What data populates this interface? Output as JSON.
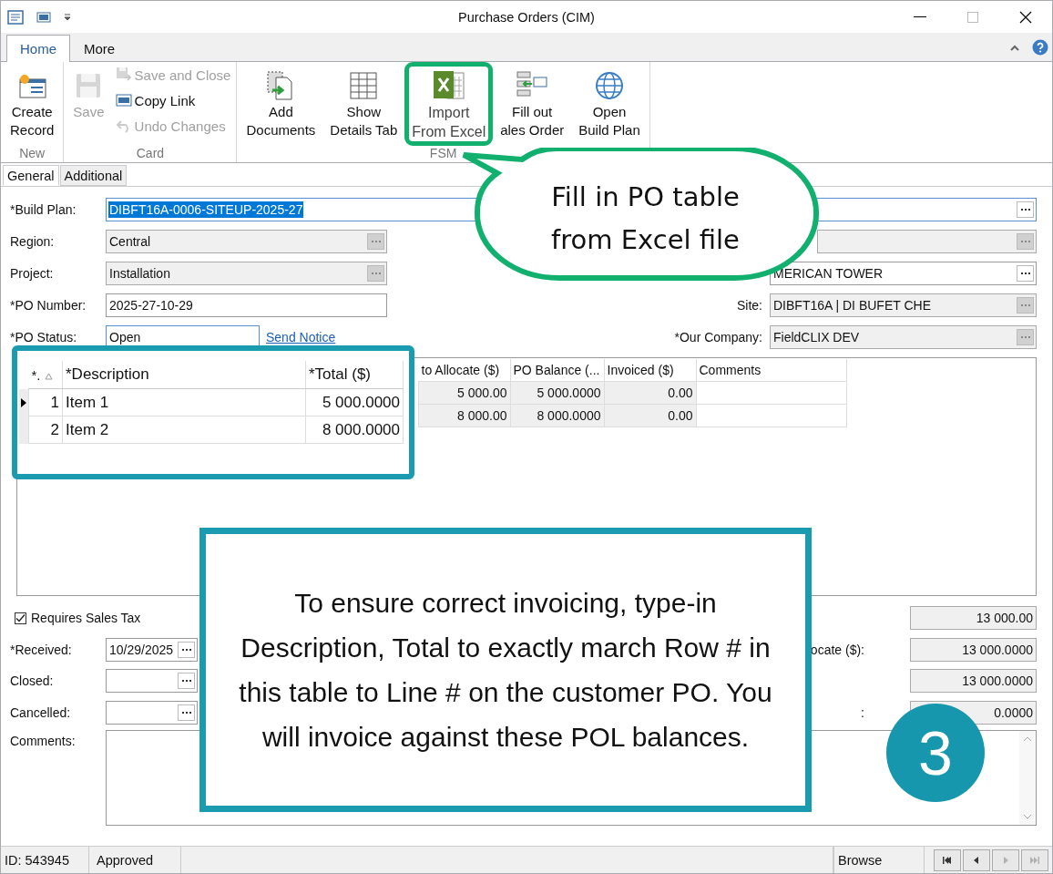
{
  "window": {
    "title": "Purchase Orders (CIM)"
  },
  "ribbon": {
    "tabs": [
      {
        "label": "Home",
        "selected": true
      },
      {
        "label": "More",
        "selected": false
      }
    ],
    "groups": [
      {
        "label": "New",
        "items": [
          {
            "kind": "large",
            "lines": [
              "Create",
              "Record"
            ],
            "disabled": false,
            "highlighted": false
          }
        ]
      },
      {
        "label": "Card",
        "items": [
          {
            "kind": "large",
            "lines": [
              "Save"
            ],
            "disabled": true,
            "highlighted": false
          },
          {
            "kind": "small",
            "lines": [
              "Save and Close"
            ],
            "disabled": true
          },
          {
            "kind": "small",
            "lines": [
              "Copy Link"
            ],
            "disabled": false
          },
          {
            "kind": "small",
            "lines": [
              "Undo Changes"
            ],
            "disabled": true
          }
        ]
      },
      {
        "label": "FSM",
        "items": [
          {
            "kind": "large",
            "lines": [
              "Add",
              "Documents"
            ],
            "disabled": false,
            "highlighted": false
          },
          {
            "kind": "large",
            "lines": [
              "Show",
              "Details Tab"
            ],
            "disabled": false,
            "highlighted": false
          },
          {
            "kind": "large",
            "lines": [
              "Import",
              "From Excel"
            ],
            "disabled": false,
            "highlighted": true
          },
          {
            "kind": "large",
            "lines": [
              "Fill out",
              "ales Order"
            ],
            "disabled": false,
            "highlighted": false
          },
          {
            "kind": "large",
            "lines": [
              "Open",
              "Build Plan"
            ],
            "disabled": false,
            "highlighted": false
          }
        ]
      }
    ]
  },
  "form_tabs": [
    {
      "label": "General",
      "selected": true
    },
    {
      "label": "Additional",
      "selected": false
    }
  ],
  "form": {
    "build_plan": {
      "label": "*Build Plan:",
      "value": "DIBFT16A-0006-SITEUP-2025-27",
      "highlighted": true
    },
    "left_fields": [
      {
        "label": "Region:",
        "value": "Central",
        "kind": "lookup",
        "disabled": true,
        "focused": false
      },
      {
        "label": "Project:",
        "value": "Installation",
        "kind": "lookup",
        "disabled": true,
        "focused": false
      },
      {
        "label": "*PO Number:",
        "value": "2025-27-10-29",
        "kind": "text",
        "disabled": false,
        "focused": false
      },
      {
        "label": "*PO Status:",
        "value": "Open",
        "kind": "text",
        "disabled": false,
        "focused": true,
        "link": "Send Notice"
      }
    ],
    "right_fields": [
      {
        "disabled": true
      },
      {
        "value": "MERICAN TOWER",
        "disabled": false
      },
      {
        "label": "Site:",
        "value": "DIBFT16A | DI BUFET CHE",
        "disabled": true
      },
      {
        "label": "*Our Company:",
        "value": "FieldCLIX DEV",
        "disabled": true
      }
    ]
  },
  "grid": {
    "columns": [
      "to Allocate ($)",
      "PO Balance (...",
      "Invoiced ($)",
      "Comments"
    ],
    "rows": [
      {
        "to_allocate": "5 000.00",
        "po_balance": "5 000.0000",
        "invoiced": "0.00"
      },
      {
        "to_allocate": "8 000.00",
        "po_balance": "8 000.0000",
        "invoiced": "0.00"
      }
    ]
  },
  "zoom_table": {
    "columns": [
      "*.",
      "*Description",
      "*Total ($)"
    ],
    "rows": [
      {
        "number": "1",
        "description": "Item 1",
        "total": "5 000.0000",
        "selected": true
      },
      {
        "number": "2",
        "description": "Item 2",
        "total": "8 000.0000",
        "selected": false
      }
    ]
  },
  "bottom": {
    "sales_tax": {
      "label": "Requires Sales Tax",
      "checked": true
    },
    "dates": [
      {
        "label": "*Received:",
        "value": "10/29/2025"
      },
      {
        "label": "Closed:"
      },
      {
        "label": "Cancelled:"
      }
    ],
    "comments": {
      "label": "Comments:"
    },
    "totals": [
      {
        "value": "13 000.00"
      },
      {
        "label": "ocate ($):",
        "value": "13 000.0000"
      },
      {
        "value": "13 000.0000"
      },
      {
        "label": ":",
        "value": "0.0000"
      }
    ]
  },
  "status_bar": {
    "id": "ID: 543945",
    "status": "Approved",
    "mode": "Browse",
    "nav": [
      {
        "disabled": false
      },
      {
        "disabled": false
      },
      {
        "disabled": true
      },
      {
        "disabled": true
      }
    ]
  },
  "annotations": {
    "callout": "Fill in PO table\nfrom Excel file",
    "note": "To ensure correct invoicing, type-in Description, Total to exactly march Row # in this table to Line # on the customer PO. You will invoice against these POL balances.",
    "step": "3"
  }
}
